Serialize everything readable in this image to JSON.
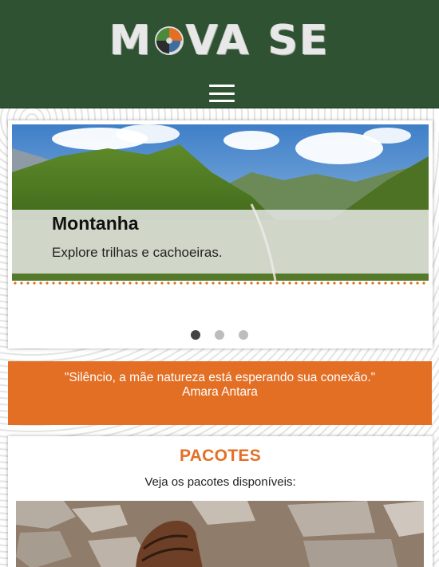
{
  "header": {
    "logo_text_left": "M",
    "logo_text_mid": "VA",
    "logo_text_right": "SE",
    "menu_icon": "hamburger-menu-icon"
  },
  "carousel": {
    "slide": {
      "title": "Montanha",
      "text": "Explore trilhas e cachoeiras."
    },
    "indicator_count": 3,
    "active_index": 0
  },
  "quote": {
    "text": "\"Silêncio, a mãe natureza está esperando sua conexão.\"",
    "author": "Amara Antara"
  },
  "packages": {
    "title": "PACOTES",
    "subtitle": "Veja os pacotes disponíveis:"
  },
  "colors": {
    "header_bg": "#2e5232",
    "accent": "#e36f25"
  }
}
